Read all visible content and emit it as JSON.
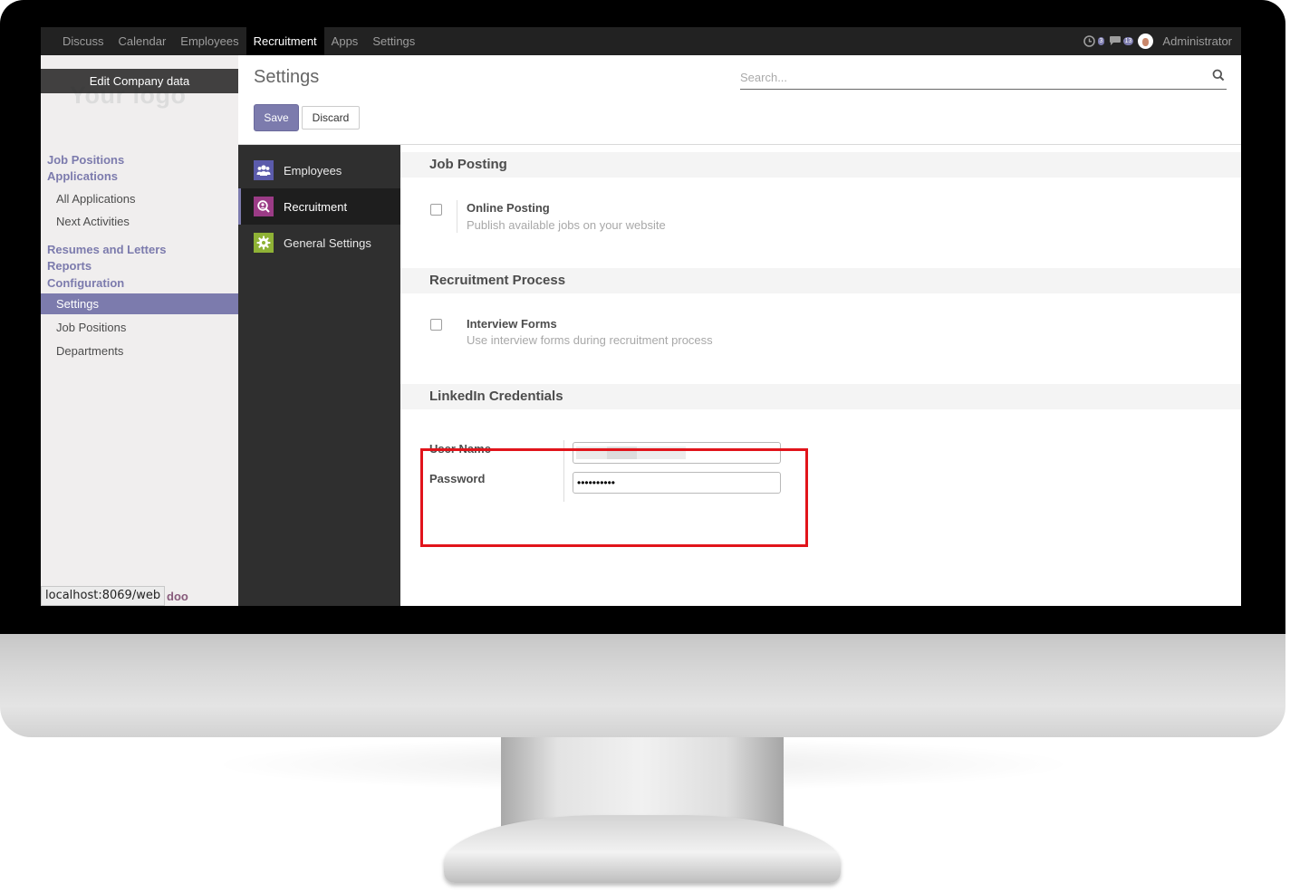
{
  "topbar": {
    "nav": [
      "Discuss",
      "Calendar",
      "Employees",
      "Recruitment",
      "Apps",
      "Settings"
    ],
    "active_nav": "Recruitment",
    "activity_count": "3",
    "message_count": "13",
    "user": "Administrator"
  },
  "sidebar": {
    "logo_text": "Your logo",
    "edit_company": "Edit Company data",
    "menu": {
      "job_positions": "Job Positions",
      "applications": "Applications",
      "all_applications": "All Applications",
      "next_activities": "Next Activities",
      "resumes": "Resumes and Letters",
      "reports": "Reports",
      "configuration": "Configuration",
      "settings": "Settings",
      "config_job_positions": "Job Positions",
      "departments": "Departments"
    },
    "status_url": "localhost:8069/web",
    "powered_suffix": "doo"
  },
  "control_panel": {
    "title": "Settings",
    "search_placeholder": "Search...",
    "save_label": "Save",
    "discard_label": "Discard"
  },
  "apps": [
    {
      "label": "Employees",
      "icon": "employees-icon",
      "color": "#5b5bab"
    },
    {
      "label": "Recruitment",
      "icon": "recruitment-icon",
      "color": "#9b3b86"
    },
    {
      "label": "General Settings",
      "icon": "gear-icon",
      "color": "#8fb236"
    }
  ],
  "content": {
    "job_posting": {
      "heading": "Job Posting",
      "title": "Online Posting",
      "desc": "Publish available jobs on your website",
      "checked": false
    },
    "recruitment_process": {
      "heading": "Recruitment Process",
      "title": "Interview Forms",
      "desc": "Use interview forms during recruitment process",
      "checked": false
    },
    "linkedin": {
      "heading": "LinkedIn Credentials",
      "username_label": "User Name",
      "password_label": "Password",
      "username_value": "",
      "password_value": "••••••••••"
    }
  },
  "colors": {
    "brand": "#7c7bad",
    "highlight": "#e1141b",
    "accent_bar": "#e9977d"
  }
}
